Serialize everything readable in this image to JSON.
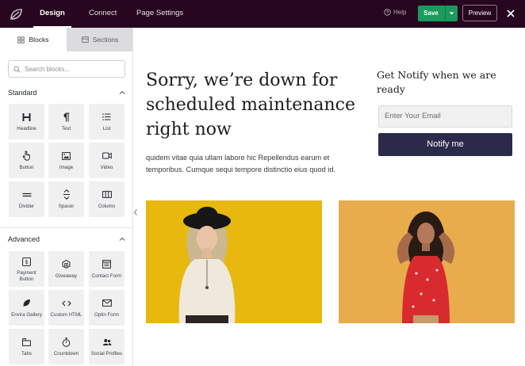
{
  "header": {
    "tabs": [
      {
        "label": "Design",
        "active": true
      },
      {
        "label": "Connect",
        "active": false
      },
      {
        "label": "Page Settings",
        "active": false
      }
    ],
    "help_label": "Help",
    "save_label": "Save",
    "preview_label": "Preview",
    "colors": {
      "bar": "#26071f",
      "save": "#1a9a5c"
    }
  },
  "sidebar": {
    "tabs": [
      {
        "label": "Blocks",
        "icon": "blocks-icon",
        "active": true
      },
      {
        "label": "Sections",
        "icon": "sections-icon",
        "active": false
      }
    ],
    "search_placeholder": "Search blocks...",
    "groups": [
      {
        "title": "Standard",
        "blocks": [
          {
            "label": "Headline",
            "icon": "headline-icon"
          },
          {
            "label": "Text",
            "icon": "paragraph-icon"
          },
          {
            "label": "List",
            "icon": "list-icon"
          },
          {
            "label": "Button",
            "icon": "pointer-icon"
          },
          {
            "label": "Image",
            "icon": "image-icon"
          },
          {
            "label": "Video",
            "icon": "video-icon"
          },
          {
            "label": "Divider",
            "icon": "divider-icon"
          },
          {
            "label": "Spacer",
            "icon": "spacer-icon"
          },
          {
            "label": "Column",
            "icon": "column-icon"
          }
        ]
      },
      {
        "title": "Advanced",
        "blocks": [
          {
            "label": "Payment Button",
            "icon": "payment-icon"
          },
          {
            "label": "Giveaway",
            "icon": "giveaway-icon"
          },
          {
            "label": "Contact Form",
            "icon": "form-icon"
          },
          {
            "label": "Envira Gallery",
            "icon": "leaf-icon"
          },
          {
            "label": "Custom HTML",
            "icon": "code-icon"
          },
          {
            "label": "Optin Form",
            "icon": "mail-icon"
          },
          {
            "label": "Tabs",
            "icon": "tabs-icon"
          },
          {
            "label": "Countdown",
            "icon": "stopwatch-icon"
          },
          {
            "label": "Social Profiles",
            "icon": "users-icon"
          }
        ]
      }
    ]
  },
  "canvas": {
    "headline": "Sorry, we’re down for scheduled maintenance right now",
    "body": "quidem vitae quia ullam labore hic Repellendus earum et temporibus. Cumque sequi tempore distinctio eius quod id.",
    "notify_title": "Get Notify when we are ready",
    "email_placeholder": "Enter Your Email",
    "notify_button": "Notify me",
    "photos": [
      {
        "background": "#e8b80f"
      },
      {
        "background": "#e9ac4c"
      }
    ]
  }
}
